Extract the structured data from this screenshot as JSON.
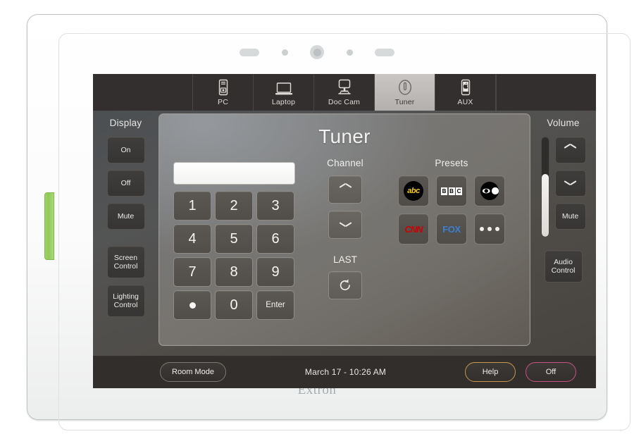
{
  "device": {
    "brand": "Extron",
    "sensors": [
      "speaker-pill",
      "indicator-dot",
      "camera-lens",
      "indicator-dot",
      "speaker-pill"
    ]
  },
  "tabbar": {
    "tabs": [
      {
        "label": "PC",
        "icon": "desktop-tower-icon",
        "active": false
      },
      {
        "label": "Laptop",
        "icon": "laptop-icon",
        "active": false
      },
      {
        "label": "Doc Cam",
        "icon": "document-camera-icon",
        "active": false
      },
      {
        "label": "Tuner",
        "icon": "tuner-dial-icon",
        "active": true
      },
      {
        "label": "AUX",
        "icon": "mobile-device-icon",
        "active": false
      }
    ]
  },
  "display_rail": {
    "title": "Display",
    "buttons": [
      {
        "label": "On"
      },
      {
        "label": "Off"
      },
      {
        "label": "Mute"
      },
      {
        "label": "Screen\nControl",
        "line1": "Screen",
        "line2": "Control"
      },
      {
        "label": "Lighting\nControl",
        "line1": "Lighting",
        "line2": "Control"
      }
    ]
  },
  "volume_rail": {
    "title": "Volume",
    "slider": {
      "level_percent": 63
    },
    "up_icon": "chevron-up-icon",
    "down_icon": "chevron-down-icon",
    "mute_label": "Mute",
    "audio_control_line1": "Audio",
    "audio_control_line2": "Control"
  },
  "panel": {
    "title": "Tuner",
    "keypad": {
      "entry_value": "",
      "entry_placeholder": "",
      "keys": [
        "1",
        "2",
        "3",
        "4",
        "5",
        "6",
        "7",
        "8",
        "9",
        "dot",
        "0",
        "Enter"
      ],
      "dot_label": "•",
      "enter_label": "Enter"
    },
    "channel": {
      "title": "Channel",
      "up_icon": "chevron-up-icon",
      "down_icon": "chevron-down-icon",
      "last_title": "LAST",
      "last_icon": "refresh-counterclockwise-icon"
    },
    "presets": {
      "title": "Presets",
      "items": [
        {
          "name": "abc",
          "icon": "abc-logo-icon",
          "text": "abc",
          "color": "#f3c916"
        },
        {
          "name": "BBC",
          "icon": "bbc-logo-icon",
          "letters": [
            "B",
            "B",
            "C"
          ]
        },
        {
          "name": "CBS",
          "icon": "cbs-eye-logo-icon"
        },
        {
          "name": "CNN",
          "icon": "cnn-logo-icon",
          "text": "CNN",
          "color": "#cc0000"
        },
        {
          "name": "FOX",
          "icon": "fox-logo-icon",
          "text": "FOX",
          "color": "#3b7fd4"
        },
        {
          "name": "More",
          "icon": "ellipsis-more-icon"
        }
      ]
    }
  },
  "bottombar": {
    "room_mode_label": "Room Mode",
    "clock": "March 17  -  10:26 AM",
    "help_label": "Help",
    "off_label": "Off",
    "help_accent": "#c59a4a",
    "off_accent": "#cc4f84"
  }
}
